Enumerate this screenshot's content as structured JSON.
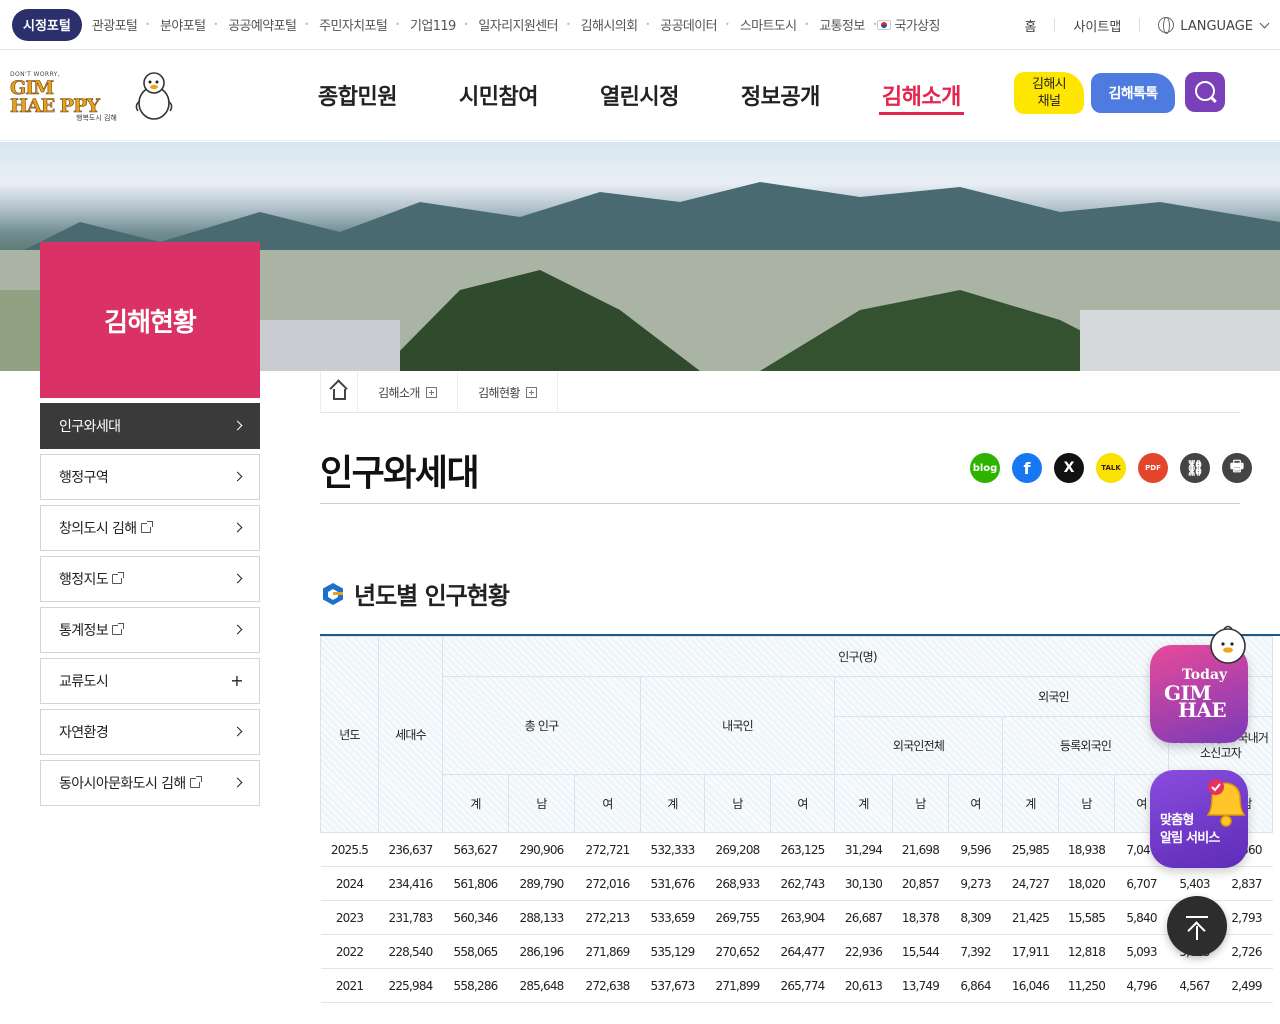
{
  "topbar": {
    "active_portal": "시정포털",
    "portals": [
      "관광포털",
      "분야포털",
      "공공예약포털",
      "주민자치포털",
      "기업119",
      "일자리지원센터",
      "김해시의회",
      "공공데이터",
      "스마트도시",
      "교통정보",
      "국가상징"
    ],
    "home": "홈",
    "sitemap": "사이트맵",
    "language": "LANGUAGE"
  },
  "header": {
    "logo_small": "DON'T WORRY,",
    "logo_line1": "GIM",
    "logo_line2": "HAE PPY",
    "logo_sub": "행복도시 김해",
    "gnb": [
      "종합민원",
      "시민참여",
      "열린시정",
      "정보공개",
      "김해소개"
    ],
    "gnb_active_index": 4,
    "channel_btn_line1": "김해시",
    "channel_btn_line2": "채널",
    "talk_btn": "김해톡톡"
  },
  "section_title": "김해현황",
  "sidebar": [
    {
      "label": "인구와세대",
      "active": true,
      "ext": false,
      "type": "chevron"
    },
    {
      "label": "행정구역",
      "active": false,
      "ext": false,
      "type": "chevron"
    },
    {
      "label": "창의도시 김해",
      "active": false,
      "ext": true,
      "type": "chevron"
    },
    {
      "label": "행정지도",
      "active": false,
      "ext": true,
      "type": "chevron"
    },
    {
      "label": "통계정보",
      "active": false,
      "ext": true,
      "type": "chevron"
    },
    {
      "label": "교류도시",
      "active": false,
      "ext": false,
      "type": "plus"
    },
    {
      "label": "자연환경",
      "active": false,
      "ext": false,
      "type": "chevron"
    },
    {
      "label": "동아시아문화도시 김해",
      "active": false,
      "ext": true,
      "type": "chevron"
    }
  ],
  "breadcrumb": [
    "김해소개",
    "김해현황"
  ],
  "page_title": "인구와세대",
  "share_icons": [
    {
      "name": "blog-icon",
      "text": "blog",
      "color": "#2db400"
    },
    {
      "name": "facebook-icon",
      "text": "f",
      "color": "#1877f2"
    },
    {
      "name": "x-icon",
      "text": "X",
      "color": "#111111"
    },
    {
      "name": "kakaotalk-icon",
      "text": "TALK",
      "color": "#fae100"
    },
    {
      "name": "pdf-icon",
      "text": "PDF",
      "color": "#e5452b"
    },
    {
      "name": "link-icon",
      "text": "⛓",
      "color": "#444444"
    },
    {
      "name": "print-icon",
      "text": "🖶",
      "color": "#444444"
    }
  ],
  "section_heading": "년도별 인구현황",
  "table": {
    "h_year": "년도",
    "h_households": "세대수",
    "h_population": "인구(명)",
    "h_total": "총 인구",
    "h_korean": "내국인",
    "h_foreign": "외국인",
    "h_foreign_all": "외국인전체",
    "h_registered": "등록외국인",
    "h_overseas": "외국국적동포 국내거소신고자",
    "h_sum": "계",
    "h_male": "남",
    "h_female": "여",
    "rows": [
      [
        "2025.5",
        "236,637",
        "563,627",
        "290,906",
        "272,721",
        "532,333",
        "269,208",
        "263,125",
        "31,294",
        "21,698",
        "9,596",
        "25,985",
        "18,938",
        "7,047",
        "",
        "2,560"
      ],
      [
        "2024",
        "234,416",
        "561,806",
        "289,790",
        "272,016",
        "531,676",
        "268,933",
        "262,743",
        "30,130",
        "20,857",
        "9,273",
        "24,727",
        "18,020",
        "6,707",
        "5,403",
        "2,837"
      ],
      [
        "2023",
        "231,783",
        "560,346",
        "288,133",
        "272,213",
        "533,659",
        "269,755",
        "263,904",
        "26,687",
        "18,378",
        "8,309",
        "21,425",
        "15,585",
        "5,840",
        "",
        "2,793"
      ],
      [
        "2022",
        "228,540",
        "558,065",
        "286,196",
        "271,869",
        "535,129",
        "270,652",
        "264,477",
        "22,936",
        "15,544",
        "7,392",
        "17,911",
        "12,818",
        "5,093",
        "5,025",
        "2,726"
      ],
      [
        "2021",
        "225,984",
        "558,286",
        "285,648",
        "272,638",
        "537,673",
        "271,899",
        "265,774",
        "20,613",
        "13,749",
        "6,864",
        "16,046",
        "11,250",
        "4,796",
        "4,567",
        "2,499"
      ]
    ]
  },
  "floating": {
    "today_line1": "Today",
    "today_line2": "GIM",
    "today_line3": "HAE",
    "alert_line1": "맞춤형",
    "alert_line2": "알림 서비스"
  }
}
